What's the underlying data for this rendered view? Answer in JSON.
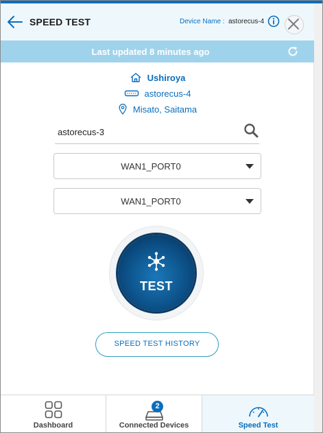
{
  "header": {
    "title": "SPEED TEST",
    "device_label": "Device Name :",
    "device_name": "astorecus-4",
    "back_icon": "arrow-left-icon",
    "info_icon": "info-icon",
    "close_icon": "close-icon"
  },
  "status": {
    "last_updated": "Last updated 8 minutes ago",
    "refresh_icon": "refresh-icon"
  },
  "location": {
    "site": "Ushiroya",
    "device": "astorecus-4",
    "place": "Misato, Saitama"
  },
  "search": {
    "value": "astorecus-3",
    "placeholder": ""
  },
  "ports": {
    "first": "WAN1_PORT0",
    "second": "WAN1_PORT0"
  },
  "test": {
    "label": "TEST"
  },
  "history": {
    "label": "SPEED TEST HISTORY"
  },
  "nav": {
    "dashboard": "Dashboard",
    "connected_devices": "Connected Devices",
    "connected_count": "2",
    "speed_test": "Speed Test",
    "active": "Speed Test"
  },
  "colors": {
    "accent": "#0a6ebd",
    "status_bar": "#9fd3ec",
    "header_bg": "#eef8fc",
    "test_button": "#0c4f86"
  }
}
